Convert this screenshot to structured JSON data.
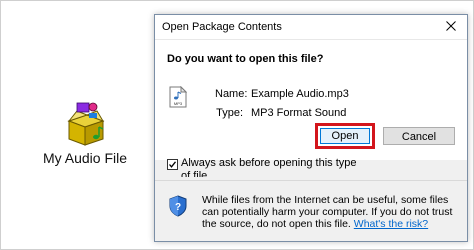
{
  "desktop": {
    "icon": "audio-package-icon",
    "label": "My Audio File"
  },
  "dialog": {
    "title": "Open Package Contents",
    "close_icon": "close-icon",
    "question": "Do you want to open this file?",
    "file": {
      "icon": "mp3-file-icon",
      "name_label": "Name:",
      "name_value": "Example Audio.mp3",
      "type_label": "Type:",
      "type_value": "MP3 Format Sound"
    },
    "buttons": {
      "open": "Open",
      "cancel": "Cancel"
    },
    "highlight_color": "#d3151c",
    "checkbox": {
      "checked": true,
      "label": "Always ask before opening this type of file"
    },
    "warning": {
      "icon": "shield-icon",
      "text": "While files from the Internet can be useful, some files can potentially harm your computer. If you do not trust the source, do not open this file.",
      "link": "What's the risk?"
    }
  }
}
